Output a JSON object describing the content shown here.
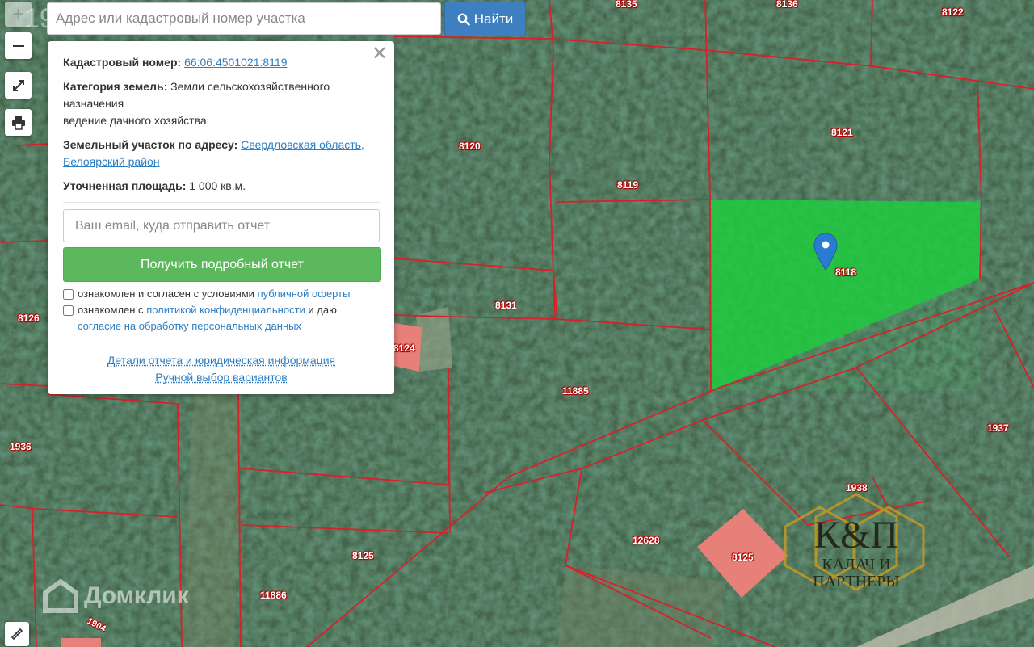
{
  "search": {
    "placeholder": "Адрес или кадастровый номер участка",
    "button_label": "Найти"
  },
  "map": {
    "zoom_level": "19",
    "plot_labels": [
      "8135",
      "8136",
      "8122",
      "8120",
      "8121",
      "8119",
      "8118",
      "8131",
      "8126",
      "11885",
      "1936",
      "1937",
      "1938",
      "12628",
      "8125",
      "8125",
      "11886",
      "1904",
      "8124"
    ],
    "highlight_color": "#1fc43c",
    "boundary_color": "#d8202a",
    "neighbor_fill": "#e8807a"
  },
  "popup": {
    "cadastral_label": "Кадастровый номер:",
    "cadastral_number": "66:06:4501021:8119",
    "category_label": "Категория земель:",
    "category_value": "Земли сельскохозяйственного назначения",
    "use_value": "ведение дачного хозяйства",
    "address_label": "Земельный участок по адресу:",
    "address_value": "Свердловская область, Белоярский район",
    "area_label": "Уточненная площадь:",
    "area_value": "1 000 кв.м.",
    "email_placeholder": "Ваш email, куда отправить отчет",
    "report_button": "Получить подробный отчет",
    "consent1_text": "ознакомлен и согласен с условиями",
    "consent1_link": "публичной оферты",
    "consent2_text": "ознакомлен с",
    "consent2_link": "политикой конфиденциальности",
    "consent2_text2": "и даю",
    "consent2_link2": "согласие на обработку персональных данных",
    "details_link": "Детали отчета и юридическая информация",
    "manual_link": "Ручной выбор вариантов"
  },
  "watermark": {
    "domclick": "Домклик",
    "brand_top": "К&П",
    "brand_line1": "КАЛАЧ И",
    "brand_line2": "ПАРТНЕРЫ"
  }
}
